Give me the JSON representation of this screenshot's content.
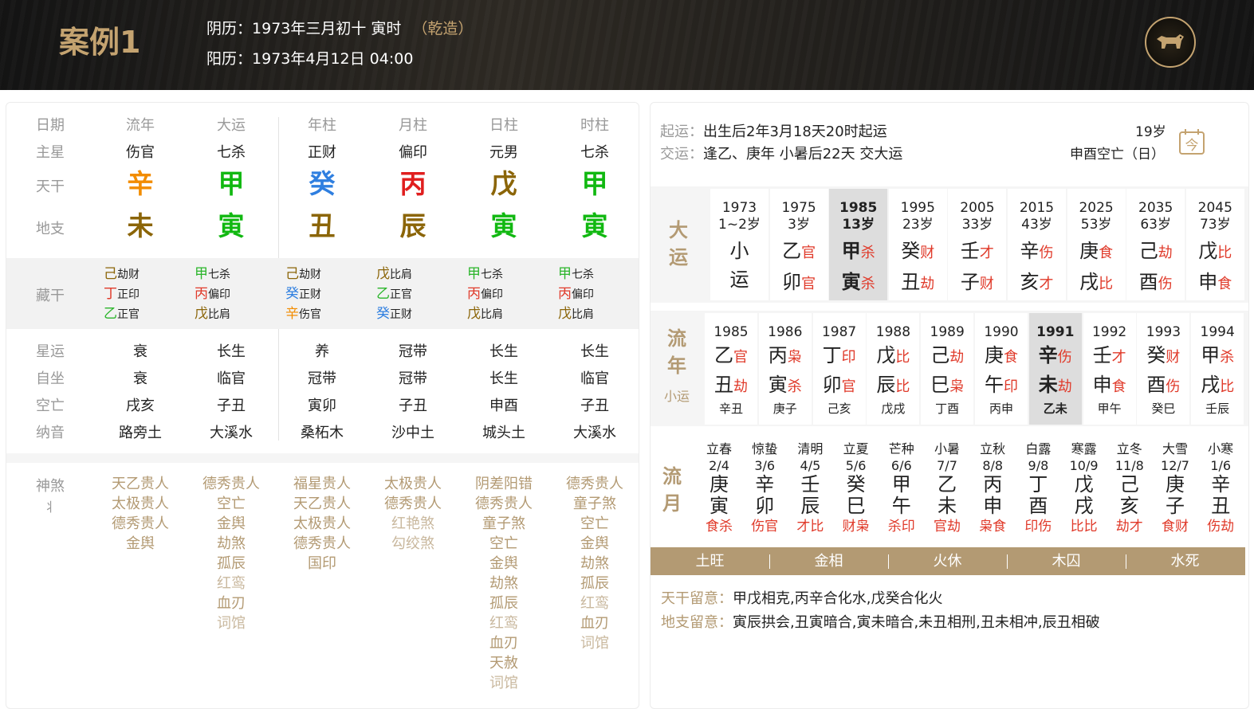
{
  "header": {
    "title": "案例1",
    "lunar_label": "阴历：",
    "lunar": "1973年三月初十 寅时",
    "qian": "（乾造）",
    "solar_label": "阳历：",
    "solar": "1973年4月12日 04:00",
    "logo_icon": "ox-zodiac-icon"
  },
  "left": {
    "labels": {
      "date": "日期",
      "zhuxing": "主星",
      "tiangan": "天干",
      "dizhi": "地支",
      "canggan": "藏干",
      "xingyun": "星运",
      "zizuo": "自坐",
      "kongwang": "空亡",
      "nayin": "纳音",
      "shensha": "神煞"
    },
    "columns": [
      {
        "head": "流年",
        "zhuxing": "伤官",
        "gan": "辛",
        "gan_color": "#f28c00",
        "zhi": "未",
        "zhi_color": "#8b6508",
        "hidden": [
          {
            "g": "己",
            "c": "#8b6508",
            "s": "劫财"
          },
          {
            "g": "丁",
            "c": "#e03a2a",
            "s": "正印"
          },
          {
            "g": "乙",
            "c": "#2bb52b",
            "s": "正官"
          }
        ],
        "xingyun": "衰",
        "zizuo": "衰",
        "kong": "戌亥",
        "nayin": "路旁土",
        "shensha": [
          "天乙贵人",
          "太极贵人",
          "德秀贵人",
          "金舆"
        ]
      },
      {
        "head": "大运",
        "zhuxing": "七杀",
        "gan": "甲",
        "gan_color": "#11b811",
        "zhi": "寅",
        "zhi_color": "#11b811",
        "hidden": [
          {
            "g": "甲",
            "c": "#2bb52b",
            "s": "七杀"
          },
          {
            "g": "丙",
            "c": "#e03a2a",
            "s": "偏印"
          },
          {
            "g": "戊",
            "c": "#8b6508",
            "s": "比肩"
          }
        ],
        "xingyun": "长生",
        "zizuo": "临官",
        "kong": "子丑",
        "nayin": "大溪水",
        "shensha": [
          "德秀贵人",
          "空亡",
          "金舆",
          "劫煞",
          "孤辰",
          "红鸾",
          "血刃",
          "词馆"
        ]
      },
      {
        "head": "年柱",
        "zhuxing": "正财",
        "gan": "癸",
        "gan_color": "#2f7fe0",
        "zhi": "丑",
        "zhi_color": "#8b6508",
        "hidden": [
          {
            "g": "己",
            "c": "#8b6508",
            "s": "劫财"
          },
          {
            "g": "癸",
            "c": "#2f7fe0",
            "s": "正财"
          },
          {
            "g": "辛",
            "c": "#f28c00",
            "s": "伤官"
          }
        ],
        "xingyun": "养",
        "zizuo": "冠带",
        "kong": "寅卯",
        "nayin": "桑柘木",
        "shensha": [
          "福星贵人",
          "天乙贵人",
          "太极贵人",
          "德秀贵人",
          "国印"
        ]
      },
      {
        "head": "月柱",
        "zhuxing": "偏印",
        "gan": "丙",
        "gan_color": "#e01e1e",
        "zhi": "辰",
        "zhi_color": "#8b6508",
        "hidden": [
          {
            "g": "戊",
            "c": "#8b6508",
            "s": "比肩"
          },
          {
            "g": "乙",
            "c": "#2bb52b",
            "s": "正官"
          },
          {
            "g": "癸",
            "c": "#2f7fe0",
            "s": "正财"
          }
        ],
        "xingyun": "冠带",
        "zizuo": "冠带",
        "kong": "子丑",
        "nayin": "沙中土",
        "shensha": [
          "太极贵人",
          "德秀贵人",
          "红艳煞",
          "勾绞煞"
        ]
      },
      {
        "head": "日柱",
        "zhuxing": "元男",
        "gan": "戊",
        "gan_color": "#8b6508",
        "zhi": "寅",
        "zhi_color": "#11b811",
        "hidden": [
          {
            "g": "甲",
            "c": "#2bb52b",
            "s": "七杀"
          },
          {
            "g": "丙",
            "c": "#e03a2a",
            "s": "偏印"
          },
          {
            "g": "戊",
            "c": "#8b6508",
            "s": "比肩"
          }
        ],
        "xingyun": "长生",
        "zizuo": "长生",
        "kong": "申酉",
        "nayin": "城头土",
        "shensha": [
          "阴差阳错",
          "德秀贵人",
          "童子煞",
          "空亡",
          "金舆",
          "劫煞",
          "孤辰",
          "红鸾",
          "血刃",
          "天赦",
          "词馆"
        ]
      },
      {
        "head": "时柱",
        "zhuxing": "七杀",
        "gan": "甲",
        "gan_color": "#11b811",
        "zhi": "寅",
        "zhi_color": "#11b811",
        "hidden": [
          {
            "g": "甲",
            "c": "#2bb52b",
            "s": "七杀"
          },
          {
            "g": "丙",
            "c": "#e03a2a",
            "s": "偏印"
          },
          {
            "g": "戊",
            "c": "#8b6508",
            "s": "比肩"
          }
        ],
        "xingyun": "长生",
        "zizuo": "临官",
        "kong": "子丑",
        "nayin": "大溪水",
        "shensha": [
          "德秀贵人",
          "童子煞",
          "空亡",
          "金舆",
          "劫煞",
          "孤辰",
          "红鸾",
          "血刃",
          "词馆"
        ]
      }
    ]
  },
  "right": {
    "qiyun_label": "起运：",
    "qiyun": "出生后2年3月18天20时起运",
    "jiaoyun_label": "交运：",
    "jiaoyun": "逢乙、庚年 小暑后22天 交大运",
    "age": "19岁",
    "kongwang": "申酉空亡（日）",
    "dayun_label": [
      "大",
      "运"
    ],
    "dayun": [
      {
        "year": "1973",
        "age": "1~2岁",
        "g": "小",
        "gs": "",
        "z": "运",
        "zs": ""
      },
      {
        "year": "1975",
        "age": "3岁",
        "g": "乙",
        "gs": "官",
        "z": "卯",
        "zs": "官"
      },
      {
        "year": "1985",
        "age": "13岁",
        "g": "甲",
        "gs": "杀",
        "z": "寅",
        "zs": "杀",
        "sel": true
      },
      {
        "year": "1995",
        "age": "23岁",
        "g": "癸",
        "gs": "财",
        "z": "丑",
        "zs": "劫"
      },
      {
        "year": "2005",
        "age": "33岁",
        "g": "壬",
        "gs": "才",
        "z": "子",
        "zs": "财"
      },
      {
        "year": "2015",
        "age": "43岁",
        "g": "辛",
        "gs": "伤",
        "z": "亥",
        "zs": "才"
      },
      {
        "year": "2025",
        "age": "53岁",
        "g": "庚",
        "gs": "食",
        "z": "戌",
        "zs": "比"
      },
      {
        "year": "2035",
        "age": "63岁",
        "g": "己",
        "gs": "劫",
        "z": "酉",
        "zs": "伤"
      },
      {
        "year": "2045",
        "age": "73岁",
        "g": "戊",
        "gs": "比",
        "z": "申",
        "zs": "食"
      }
    ],
    "liunian_label": [
      "流",
      "年"
    ],
    "xiaoyun_label": "小运",
    "liunian": [
      {
        "year": "1985",
        "g": "乙",
        "gs": "官",
        "z": "丑",
        "zs": "劫",
        "x": "辛丑"
      },
      {
        "year": "1986",
        "g": "丙",
        "gs": "枭",
        "z": "寅",
        "zs": "杀",
        "x": "庚子"
      },
      {
        "year": "1987",
        "g": "丁",
        "gs": "印",
        "z": "卯",
        "zs": "官",
        "x": "己亥"
      },
      {
        "year": "1988",
        "g": "戊",
        "gs": "比",
        "z": "辰",
        "zs": "比",
        "x": "戊戌"
      },
      {
        "year": "1989",
        "g": "己",
        "gs": "劫",
        "z": "巳",
        "zs": "枭",
        "x": "丁酉"
      },
      {
        "year": "1990",
        "g": "庚",
        "gs": "食",
        "z": "午",
        "zs": "印",
        "x": "丙申"
      },
      {
        "year": "1991",
        "g": "辛",
        "gs": "伤",
        "z": "未",
        "zs": "劫",
        "x": "乙未",
        "sel": true
      },
      {
        "year": "1992",
        "g": "壬",
        "gs": "才",
        "z": "申",
        "zs": "食",
        "x": "甲午"
      },
      {
        "year": "1993",
        "g": "癸",
        "gs": "财",
        "z": "酉",
        "zs": "伤",
        "x": "癸巳"
      },
      {
        "year": "1994",
        "g": "甲",
        "gs": "杀",
        "z": "戌",
        "zs": "比",
        "x": "壬辰"
      }
    ],
    "liuyue_label": [
      "流",
      "月"
    ],
    "liuyue": [
      {
        "jq": "立春",
        "dt": "2/4",
        "g": "庚",
        "z": "寅",
        "ss": "食杀"
      },
      {
        "jq": "惊蛰",
        "dt": "3/6",
        "g": "辛",
        "z": "卯",
        "ss": "伤官"
      },
      {
        "jq": "清明",
        "dt": "4/5",
        "g": "壬",
        "z": "辰",
        "ss": "才比"
      },
      {
        "jq": "立夏",
        "dt": "5/6",
        "g": "癸",
        "z": "巳",
        "ss": "财枭"
      },
      {
        "jq": "芒种",
        "dt": "6/6",
        "g": "甲",
        "z": "午",
        "ss": "杀印"
      },
      {
        "jq": "小暑",
        "dt": "7/7",
        "g": "乙",
        "z": "未",
        "ss": "官劫"
      },
      {
        "jq": "立秋",
        "dt": "8/8",
        "g": "丙",
        "z": "申",
        "ss": "枭食"
      },
      {
        "jq": "白露",
        "dt": "9/8",
        "g": "丁",
        "z": "酉",
        "ss": "印伤"
      },
      {
        "jq": "寒露",
        "dt": "10/9",
        "g": "戊",
        "z": "戌",
        "ss": "比比"
      },
      {
        "jq": "立冬",
        "dt": "11/8",
        "g": "己",
        "z": "亥",
        "ss": "劫才"
      },
      {
        "jq": "大雪",
        "dt": "12/7",
        "g": "庚",
        "z": "子",
        "ss": "食财"
      },
      {
        "jq": "小寒",
        "dt": "1/6",
        "g": "辛",
        "z": "丑",
        "ss": "伤劫"
      }
    ],
    "wuxing": [
      "土旺",
      "金相",
      "火休",
      "木囚",
      "水死"
    ],
    "tiangan_note_label": "天干留意：",
    "tiangan_note": "甲戊相克,丙辛合化水,戊癸合化火",
    "dizhi_note_label": "地支留意：",
    "dizhi_note": "寅辰拱会,丑寅暗合,寅未暗合,未丑相刑,丑未相冲,辰丑相破",
    "calendar_icon": "calendar-today-icon",
    "calendar_char": "今"
  },
  "colors": {
    "gold": "#b39a73",
    "red": "#e03a2a"
  }
}
